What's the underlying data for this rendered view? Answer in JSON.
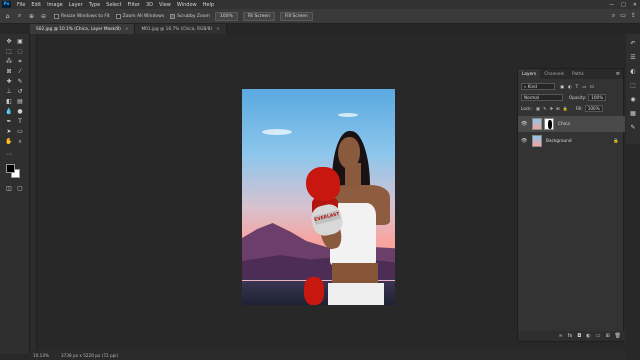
{
  "app": {
    "logo": "Ps"
  },
  "menu": [
    "File",
    "Edit",
    "Image",
    "Layer",
    "Type",
    "Select",
    "Filter",
    "3D",
    "View",
    "Window",
    "Help"
  ],
  "window_controls": [
    "—",
    "□",
    "✕"
  ],
  "options": {
    "resize_windows": "Resize Windows to Fit",
    "zoom_all_windows": "Zoom All Windows",
    "scrubby_zoom": "Scrubby Zoom",
    "zoom_100": "100%",
    "fit_screen": "Fit Screen",
    "fill_screen": "Fill Screen"
  },
  "tabs": [
    {
      "label": "S02.jpg @ 10.1% (Chica, Layer Mask/8)",
      "close": "×"
    },
    {
      "label": "M01.jpg @ 16.7% (Chica, RGB/8)",
      "close": "×"
    }
  ],
  "canvas": {
    "glove_text": "EVERLAST"
  },
  "layers_panel": {
    "tabs": [
      "Layers",
      "Channels",
      "Paths"
    ],
    "kind_label": "Kind",
    "blend_mode": "Normal",
    "opacity_label": "Opacity:",
    "opacity_value": "100%",
    "lock_label": "Lock:",
    "fill_label": "Fill:",
    "fill_value": "100%",
    "layers": [
      {
        "name": "Chica",
        "selected": true
      },
      {
        "name": "Background",
        "selected": false
      }
    ]
  },
  "status": {
    "zoom": "10.14%",
    "doc_size": "3738 px x 5220 px (72 ppi)"
  }
}
